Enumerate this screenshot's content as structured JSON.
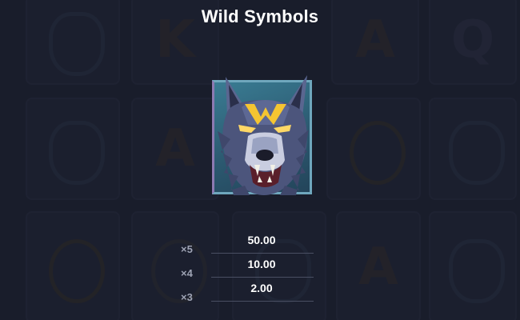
{
  "title": "Wild Symbols",
  "symbol": {
    "icon": "wolf-wild-icon",
    "letter": "W"
  },
  "paytable": [
    {
      "multiplier": "×5",
      "value": "50.00"
    },
    {
      "multiplier": "×4",
      "value": "10.00"
    },
    {
      "multiplier": "×3",
      "value": "2.00"
    }
  ],
  "background_symbols": [
    "K",
    "A",
    "Q",
    "A",
    "A"
  ],
  "colors": {
    "background": "#1d2130",
    "title": "#ffffff",
    "multiplier": "#9ea3b4",
    "value": "#ffffff",
    "wild_accent": "#f5c531"
  }
}
